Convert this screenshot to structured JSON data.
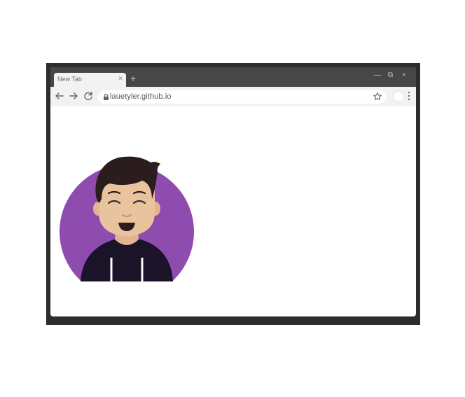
{
  "browser": {
    "tab": {
      "title": "New Tab",
      "close_symbol": "×"
    },
    "new_tab_symbol": "+",
    "window_controls": {
      "minimize": "—",
      "restore": "⧉",
      "close": "×"
    },
    "address": {
      "url": "lauetyler.github.io"
    },
    "icons": {
      "back": "back-arrow-icon",
      "forward": "forward-arrow-icon",
      "reload": "reload-icon",
      "lock": "lock-icon",
      "bookmark": "star-icon",
      "profile": "profile-icon",
      "menu": "menu-dots-icon"
    }
  },
  "content": {
    "illustration": "avatar-illustration",
    "colors": {
      "circle": "#8e4caf",
      "hair": "#2b1d1d",
      "skin": "#e9c29e",
      "hoodie": "#1b1328"
    }
  }
}
